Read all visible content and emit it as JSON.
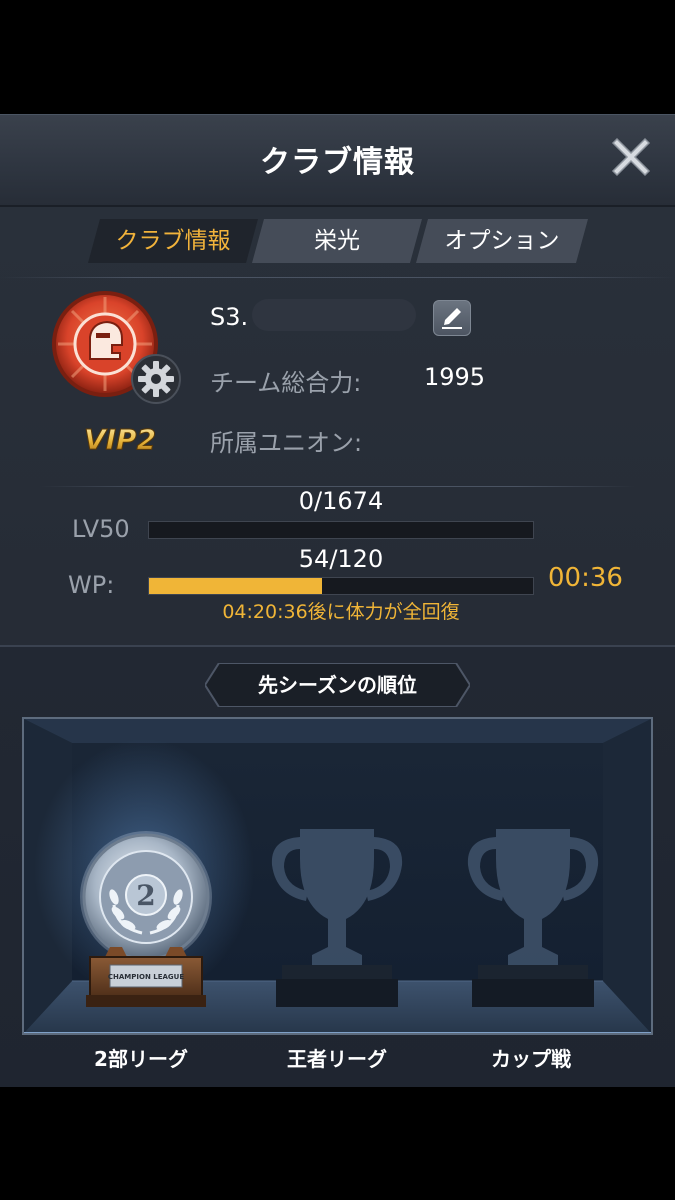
{
  "header": {
    "title": "クラブ情報"
  },
  "tabs": [
    {
      "label": "クラブ情報",
      "active": true
    },
    {
      "label": "栄光",
      "active": false
    },
    {
      "label": "オプション",
      "active": false
    }
  ],
  "club": {
    "name": "S3.",
    "vip": "VIP2",
    "team_power_label": "チーム総合力:",
    "team_power_value": "1995",
    "union_label": "所属ユニオン:",
    "union_value": ""
  },
  "level": {
    "label": "LV50",
    "progress_text": "0/1674",
    "progress": 0.0
  },
  "wp": {
    "label": "WP:",
    "progress_text": "54/120",
    "progress": 0.45,
    "timer": "00:36",
    "recover_text": "04:20:36後に体力が全回復"
  },
  "season": {
    "title": "先シーズンの順位",
    "trophies": [
      {
        "label": "2部リーグ",
        "earned": true,
        "rank": "2",
        "plaque": "CHAMPION LEAGUE"
      },
      {
        "label": "王者リーグ",
        "earned": false
      },
      {
        "label": "カップ戦",
        "earned": false
      }
    ]
  },
  "colors": {
    "accent": "#f0b537",
    "active_tab": "#f2b33b",
    "emblem": "#d9432a"
  }
}
